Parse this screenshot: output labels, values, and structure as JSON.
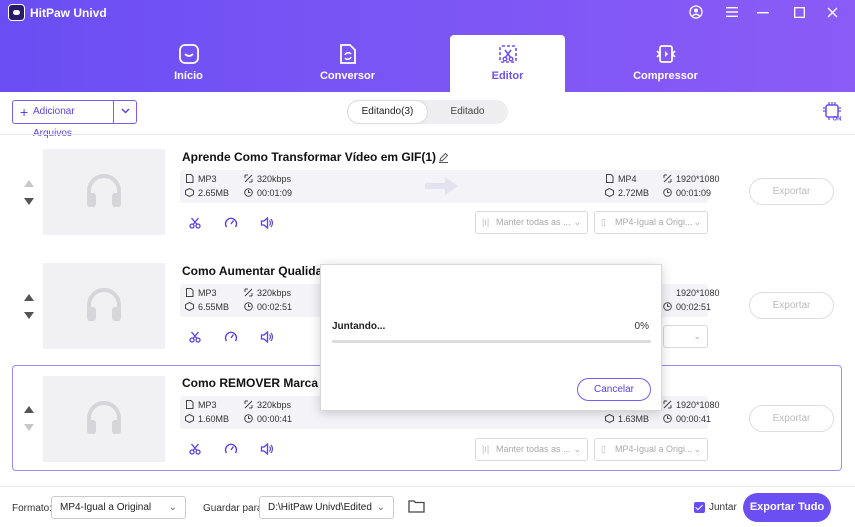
{
  "app": {
    "title": "HitPaw Univd"
  },
  "nav": {
    "tabs": [
      {
        "label": "Início",
        "active": false
      },
      {
        "label": "Conversor",
        "active": false
      },
      {
        "label": "Editor",
        "active": true
      },
      {
        "label": "Compressor",
        "active": false
      }
    ]
  },
  "toolbar": {
    "add_files_label": "Adicionar Arquivos",
    "segments": {
      "editing": "Editando(3)",
      "edited": "Editado"
    }
  },
  "items": [
    {
      "title": "Aprende Como Transformar Vídeo em GIF(1)",
      "src": {
        "format": "MP3",
        "bitrate": "320kbps",
        "size": "2.65MB",
        "duration": "00:01:09"
      },
      "out": {
        "format": "MP4",
        "resolution": "1920*1080",
        "size": "2.72MB",
        "duration": "00:01:09"
      },
      "audio_select": "Manter todas as ...",
      "format_select": "MP4-Igual a Origi...",
      "export_label": "Exportar"
    },
    {
      "title": "Como Aumentar Qualidad",
      "src": {
        "format": "MP3",
        "bitrate": "320kbps",
        "size": "6.55MB",
        "duration": "00:02:51"
      },
      "out": {
        "format": "",
        "resolution": "1920*1080",
        "size": "",
        "duration": "00:02:51"
      },
      "audio_select": "",
      "format_select": "",
      "export_label": "Exportar"
    },
    {
      "title": "Como REMOVER Marca D'",
      "src": {
        "format": "MP3",
        "bitrate": "320kbps",
        "size": "1.60MB",
        "duration": "00:00:41"
      },
      "out": {
        "format": "",
        "resolution": "1920*1080",
        "size": "1.63MB",
        "duration": "00:00:41"
      },
      "audio_select": "Manter todas as ...",
      "format_select": "MP4-Igual a Origi...",
      "export_label": "Exportar"
    }
  ],
  "bottom": {
    "format_label": "Formato:",
    "format_value": "MP4-Igual a Original",
    "save_label": "Guardar para:",
    "save_value": "D:\\HitPaw Univd\\Edited",
    "merge_label": "Juntar",
    "merge_checked": true,
    "export_all_label": "Exportar Tudo"
  },
  "modal": {
    "title": "Juntando...",
    "percent": "0%",
    "progress": 0,
    "cancel_label": "Cancelar"
  },
  "colors": {
    "accent": "#6a4ef3",
    "accent_light": "#9d8bf6"
  }
}
